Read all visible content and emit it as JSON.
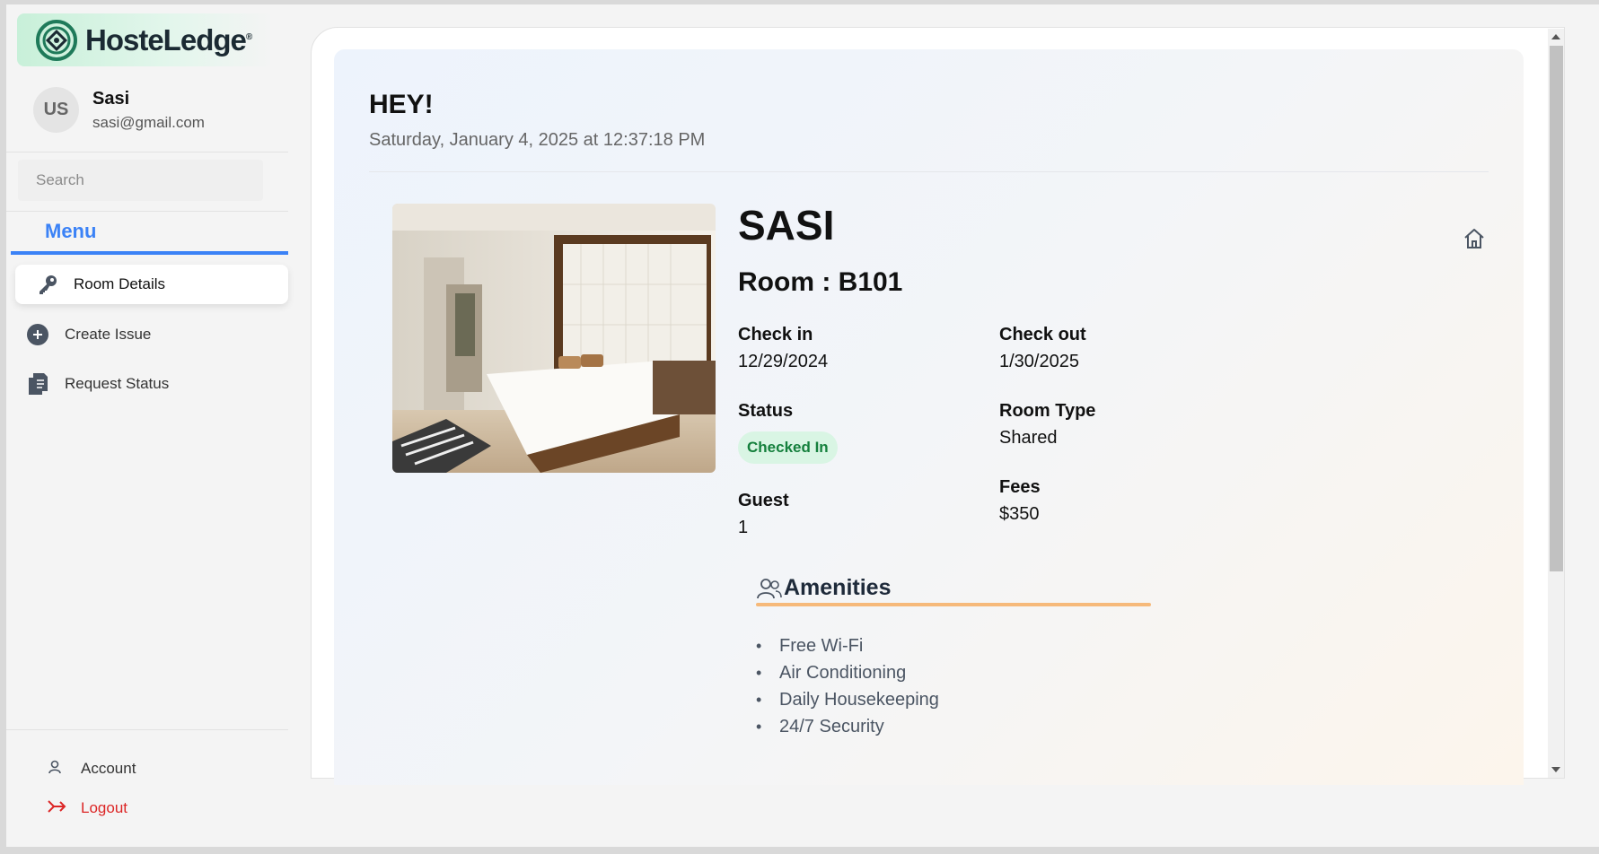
{
  "brand": {
    "name": "HosteLedge",
    "reg": "®"
  },
  "user": {
    "initials": "US",
    "name": "Sasi",
    "email": "sasi@gmail.com"
  },
  "search": {
    "placeholder": "Search"
  },
  "menu": {
    "title": "Menu",
    "items": [
      {
        "label": "Room Details",
        "icon": "key-icon",
        "active": true
      },
      {
        "label": "Create Issue",
        "icon": "plus-circle-icon",
        "active": false
      },
      {
        "label": "Request Status",
        "icon": "clipboard-icon",
        "active": false
      }
    ]
  },
  "bottom": {
    "account": "Account",
    "logout": "Logout"
  },
  "colors": {
    "accent": "#3b82f6",
    "logout": "#dc2626",
    "status_bg": "#d9f5e4",
    "status_fg": "#15803d",
    "amenities_line": "#f6b97a"
  },
  "main": {
    "greeting": "HEY!",
    "datetime": "Saturday, January 4, 2025 at 12:37:18 PM",
    "guest_name": "SASI",
    "room": "Room : B101",
    "check_in_label": "Check in",
    "check_in": "12/29/2024",
    "check_out_label": "Check out",
    "check_out": "1/30/2025",
    "status_label": "Status",
    "status": "Checked In",
    "room_type_label": "Room Type",
    "room_type": "Shared",
    "fees_label": "Fees",
    "fees": "$350",
    "guest_label": "Guest",
    "guest": "1",
    "amenities_title": "Amenities",
    "amenities": [
      "Free Wi-Fi",
      "Air Conditioning",
      "Daily Housekeeping",
      "24/7 Security"
    ]
  }
}
